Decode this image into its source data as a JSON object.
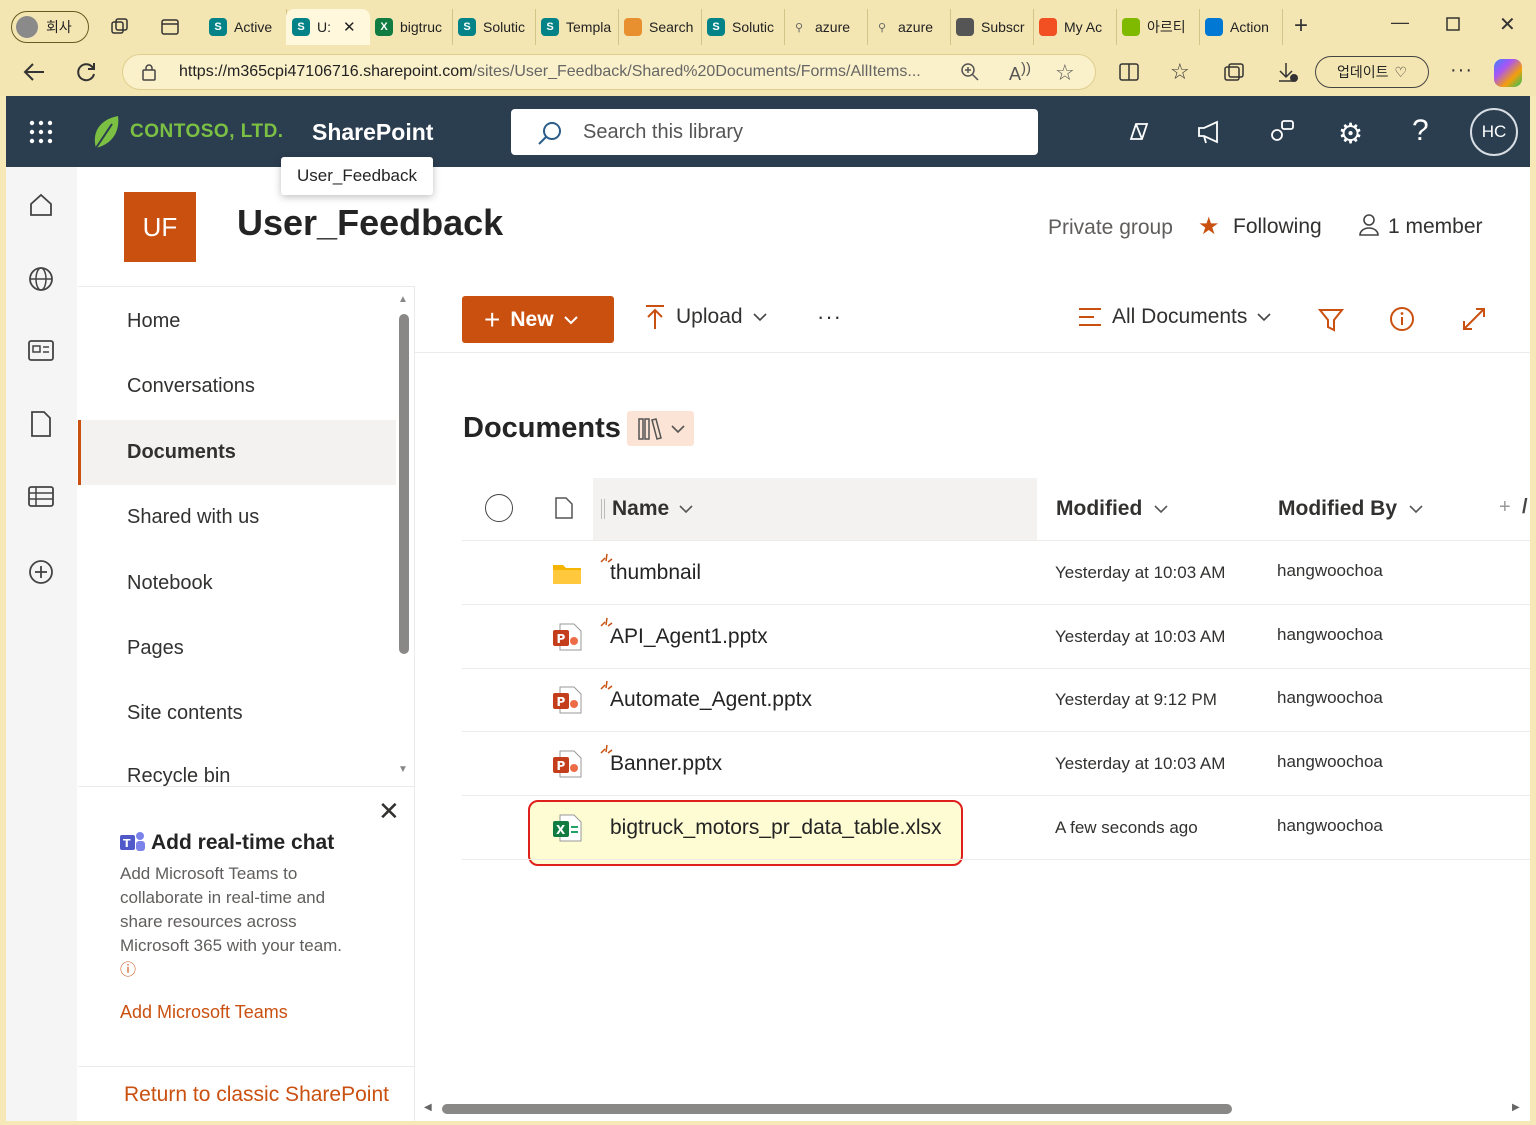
{
  "browser": {
    "profile_label": "회사",
    "tabs": [
      {
        "label": "Active",
        "icon": "sharepoint-icon"
      },
      {
        "label": "U:",
        "icon": "sharepoint-icon",
        "active": true
      },
      {
        "label": "bigtruc",
        "icon": "excel-icon"
      },
      {
        "label": "Solutic",
        "icon": "sharepoint-icon"
      },
      {
        "label": "Templa",
        "icon": "sharepoint-icon"
      },
      {
        "label": "Search",
        "icon": "search-ms-icon"
      },
      {
        "label": "Solutic",
        "icon": "sharepoint-icon"
      },
      {
        "label": "azure",
        "icon": "search-icon"
      },
      {
        "label": "azure",
        "icon": "search-icon"
      },
      {
        "label": "Subscr",
        "icon": "azure-icon"
      },
      {
        "label": "My Ac",
        "icon": "microsoft-icon"
      },
      {
        "label": "아르티",
        "icon": "app-icon"
      },
      {
        "label": "Action",
        "icon": "cloud-icon"
      }
    ],
    "url_host": "https://m365cpi47106716.sharepoint.com",
    "url_path": "/sites/User_Feedback/Shared%20Documents/Forms/AllItems...",
    "update_label": "업데이트"
  },
  "header": {
    "company": "CONTOSO, LTD.",
    "app_name": "SharePoint",
    "search_placeholder": "Search this library",
    "avatar_initials": "HC",
    "tooltip": "User_Feedback"
  },
  "site": {
    "logo_initials": "UF",
    "title": "User_Feedback",
    "privacy": "Private group",
    "following_label": "Following",
    "members_label": "1 member"
  },
  "nav": {
    "items": [
      "Home",
      "Conversations",
      "Documents",
      "Shared with us",
      "Notebook",
      "Pages",
      "Site contents",
      "Recycle bin"
    ],
    "selected": "Documents"
  },
  "promo": {
    "title": "Add real-time chat",
    "body": "Add Microsoft Teams to collaborate in real-time and share resources across Microsoft 365 with your team.",
    "link": "Add Microsoft Teams",
    "classic_link": "Return to classic SharePoint"
  },
  "toolbar": {
    "new_label": "New",
    "upload_label": "Upload",
    "view_label": "All Documents"
  },
  "library": {
    "title": "Documents",
    "columns": {
      "name": "Name",
      "modified": "Modified",
      "modified_by": "Modified By"
    },
    "files": [
      {
        "name": "thumbnail",
        "type": "folder",
        "modified": "Yesterday at 10:03 AM",
        "by": "hangwoochoa"
      },
      {
        "name": "API_Agent1.pptx",
        "type": "pptx",
        "modified": "Yesterday at 10:03 AM",
        "by": "hangwoochoa"
      },
      {
        "name": "Automate_Agent.pptx",
        "type": "pptx",
        "modified": "Yesterday at 9:12 PM",
        "by": "hangwoochoa"
      },
      {
        "name": "Banner.pptx",
        "type": "pptx",
        "modified": "Yesterday at 10:03 AM",
        "by": "hangwoochoa"
      },
      {
        "name": "bigtruck_motors_pr_data_table.xlsx",
        "type": "xlsx",
        "modified": "A few seconds ago",
        "by": "hangwoochoa",
        "highlighted": true
      }
    ]
  },
  "colors": {
    "accent": "#ca5010",
    "header_bg": "#2b3e50",
    "browser_bg": "#f4e6b3",
    "highlight_border": "#e0201c",
    "highlight_fill": "#fdfcd2"
  }
}
